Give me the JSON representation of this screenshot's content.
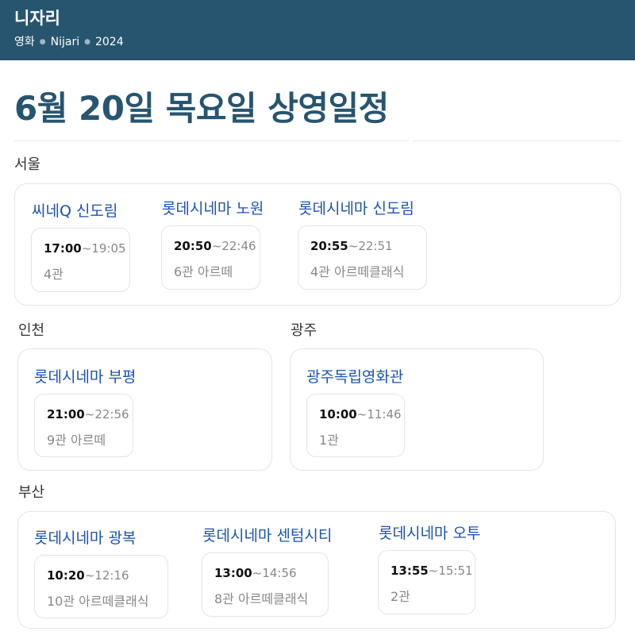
{
  "header": {
    "title": "니자리",
    "crumbs": [
      "영화",
      "Nijari",
      "2024"
    ]
  },
  "page_title": "6월 20일 목요일 상영일정",
  "regions": [
    {
      "name": "서울",
      "theaters": [
        {
          "name": "씨네Q 신도림",
          "showtimes": [
            {
              "start": "17:00",
              "end": "~19:05",
              "screen": "4관"
            }
          ]
        },
        {
          "name": "롯데시네마 노원",
          "showtimes": [
            {
              "start": "20:50",
              "end": "~22:46",
              "screen": "6관 아르떼"
            }
          ]
        },
        {
          "name": "롯데시네마 신도림",
          "showtimes": [
            {
              "start": "20:55",
              "end": "~22:51",
              "screen": "4관 아르떼클래식"
            }
          ]
        }
      ]
    },
    {
      "name": "인천",
      "theaters": [
        {
          "name": "롯데시네마 부평",
          "showtimes": [
            {
              "start": "21:00",
              "end": "~22:56",
              "screen": "9관 아르떼"
            }
          ]
        }
      ]
    },
    {
      "name": "광주",
      "theaters": [
        {
          "name": "광주독립영화관",
          "showtimes": [
            {
              "start": "10:00",
              "end": "~11:46",
              "screen": "1관"
            }
          ]
        }
      ]
    },
    {
      "name": "부산",
      "theaters": [
        {
          "name": "롯데시네마 광복",
          "showtimes": [
            {
              "start": "10:20",
              "end": "~12:16",
              "screen": "10관 아르떼클래식"
            }
          ]
        },
        {
          "name": "롯데시네마 센텀시티",
          "showtimes": [
            {
              "start": "13:00",
              "end": "~14:56",
              "screen": "8관 아르떼클래식"
            }
          ]
        },
        {
          "name": "롯데시네마 오투",
          "showtimes": [
            {
              "start": "13:55",
              "end": "~15:51",
              "screen": "2관"
            }
          ]
        }
      ]
    }
  ],
  "colors": {
    "header_bg": "#275570",
    "title": "#275570",
    "theater_link": "#1a53b5"
  }
}
